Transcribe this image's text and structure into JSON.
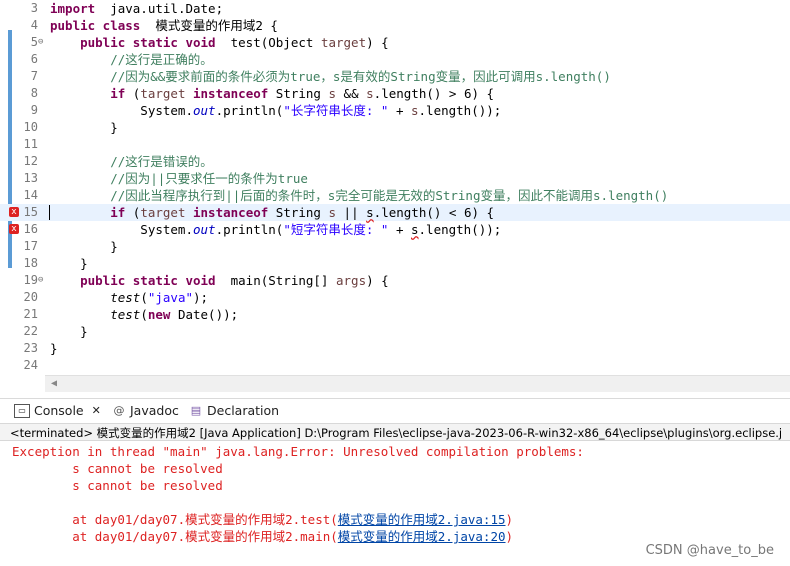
{
  "editor": {
    "lines": [
      {
        "n": "3",
        "tokens": [
          [
            "kw",
            "import"
          ],
          [
            "",
            "  java.util.Date;"
          ]
        ]
      },
      {
        "n": "4",
        "tokens": [
          [
            "kw",
            "public class"
          ],
          [
            "",
            "  模式变量的作用域2 {"
          ]
        ]
      },
      {
        "n": "5",
        "tokens": [
          [
            "kw",
            "    public static void"
          ],
          [
            "",
            "  test(Object "
          ],
          [
            "par",
            "target"
          ],
          [
            "",
            ") {"
          ]
        ]
      },
      {
        "n": "6",
        "tokens": [
          [
            "cm",
            "        //这行是正确的。"
          ]
        ]
      },
      {
        "n": "7",
        "tokens": [
          [
            "cm",
            "        //因为&&要求前面的条件必须为true，s是有效的String变量，因此可调用s.length()"
          ]
        ]
      },
      {
        "n": "8",
        "tokens": [
          [
            "kw",
            "        if"
          ],
          [
            "",
            " ("
          ],
          [
            "par",
            "target"
          ],
          [
            "kw",
            " instanceof"
          ],
          [
            "",
            " String "
          ],
          [
            "par",
            "s"
          ],
          [
            "",
            " && "
          ],
          [
            "par",
            "s"
          ],
          [
            "",
            ".length() > 6) {"
          ]
        ]
      },
      {
        "n": "9",
        "tokens": [
          [
            "",
            "            System."
          ],
          [
            "fld",
            "out"
          ],
          [
            "",
            ".println("
          ],
          [
            "str",
            "\"长字符串长度: \""
          ],
          [
            "",
            " + "
          ],
          [
            "par",
            "s"
          ],
          [
            "",
            ".length());"
          ]
        ]
      },
      {
        "n": "10",
        "tokens": [
          [
            "",
            "        }"
          ]
        ]
      },
      {
        "n": "11",
        "tokens": [
          [
            "",
            ""
          ]
        ]
      },
      {
        "n": "12",
        "tokens": [
          [
            "cm",
            "        //这行是错误的。"
          ]
        ]
      },
      {
        "n": "13",
        "tokens": [
          [
            "cm",
            "        //因为||只要求任一的条件为true"
          ]
        ]
      },
      {
        "n": "14",
        "tokens": [
          [
            "cm",
            "        //因此当程序执行到||后面的条件时，s完全可能是无效的String变量，因此不能调用s.length()"
          ]
        ]
      },
      {
        "n": "15",
        "tokens": [
          [
            "kw",
            "        if"
          ],
          [
            "",
            " ("
          ],
          [
            "par",
            "target"
          ],
          [
            "kw",
            " instanceof"
          ],
          [
            "",
            " String "
          ],
          [
            "par",
            "s"
          ],
          [
            "",
            " || "
          ],
          [
            "err",
            "s"
          ],
          [
            "",
            ".length() < 6) {"
          ]
        ]
      },
      {
        "n": "16",
        "tokens": [
          [
            "",
            "            System."
          ],
          [
            "fld",
            "out"
          ],
          [
            "",
            ".println("
          ],
          [
            "str",
            "\"短字符串长度: \""
          ],
          [
            "",
            " + "
          ],
          [
            "err",
            "s"
          ],
          [
            "",
            ".length());"
          ]
        ]
      },
      {
        "n": "17",
        "tokens": [
          [
            "",
            "        }"
          ]
        ]
      },
      {
        "n": "18",
        "tokens": [
          [
            "",
            "    }"
          ]
        ]
      },
      {
        "n": "19",
        "tokens": [
          [
            "kw",
            "    public static void"
          ],
          [
            "",
            "  main(String[] "
          ],
          [
            "par",
            "args"
          ],
          [
            "",
            ") {"
          ]
        ]
      },
      {
        "n": "20",
        "tokens": [
          [
            "mth",
            "        test"
          ],
          [
            "",
            "("
          ],
          [
            "str",
            "\"java\""
          ],
          [
            "",
            ");"
          ]
        ]
      },
      {
        "n": "21",
        "tokens": [
          [
            "mth",
            "        test"
          ],
          [
            "",
            "("
          ],
          [
            "kw",
            "new"
          ],
          [
            "",
            " Date());"
          ]
        ]
      },
      {
        "n": "22",
        "tokens": [
          [
            "",
            "    }"
          ]
        ]
      },
      {
        "n": "23",
        "tokens": [
          [
            "",
            "}"
          ]
        ]
      },
      {
        "n": "24",
        "tokens": [
          [
            "",
            ""
          ]
        ]
      }
    ],
    "error_marker": "x",
    "hscroll_arrow": "◀"
  },
  "tabs": [
    {
      "label": "Console",
      "icon": "console-icon",
      "glyph": "▭",
      "close": "✕"
    },
    {
      "label": "Javadoc",
      "icon": "javadoc-icon",
      "glyph": "@"
    },
    {
      "label": "Declaration",
      "icon": "declaration-icon",
      "glyph": "▤"
    }
  ],
  "status": "<terminated> 模式变量的作用域2 [Java Application] D:\\Program Files\\eclipse-java-2023-06-R-win32-x86_64\\eclipse\\plugins\\org.eclipse.j",
  "console": {
    "l1": "Exception in thread \"main\" java.lang.Error: Unresolved compilation problems: ",
    "l2": "        s cannot be resolved",
    "l3": "        s cannot be resolved",
    "l4a": "        at day01/day07.模式变量的作用域2.test(",
    "l4link": "模式变量的作用域2.java:15",
    "l4b": ")",
    "l5a": "        at day01/day07.模式变量的作用域2.main(",
    "l5link": "模式变量的作用域2.java:20",
    "l5b": ")"
  },
  "watermark": "CSDN @have_to_be",
  "colors": {
    "keyword": "#7f0055",
    "comment": "#3f7f5f",
    "string": "#2a00ff",
    "error": "#d22222",
    "link": "#0045a6"
  }
}
